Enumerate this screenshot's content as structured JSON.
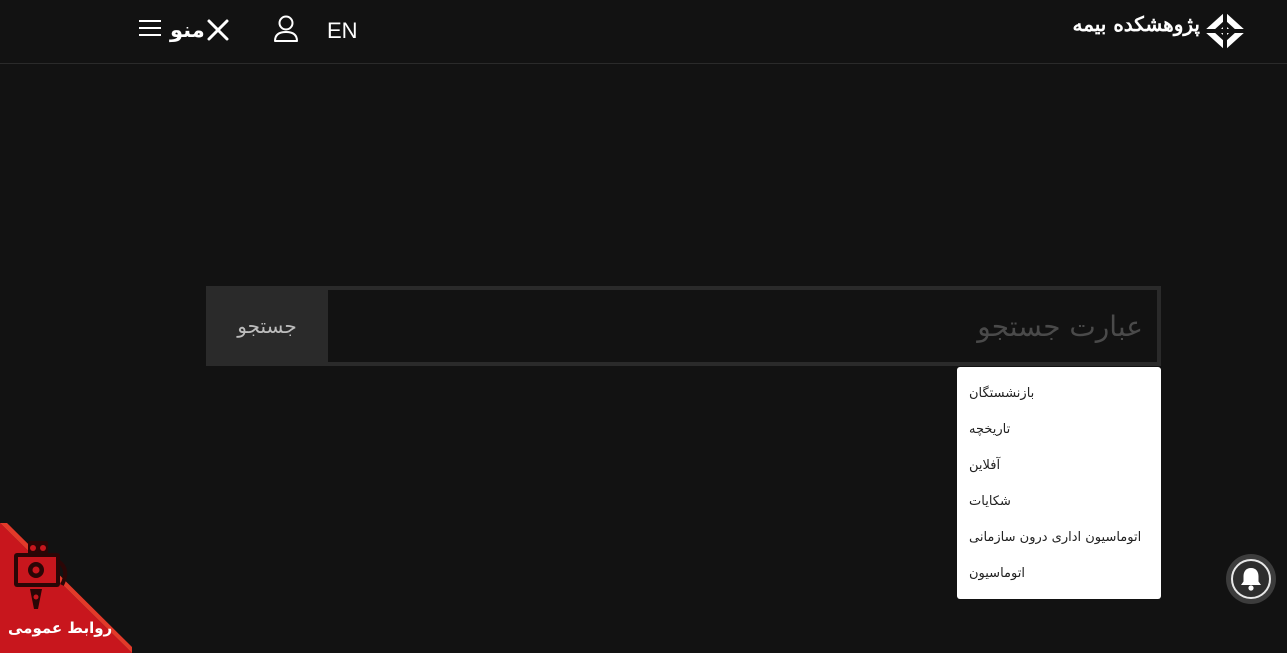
{
  "header": {
    "menu_label": "منو",
    "lang_label": "EN",
    "logo_text": "پژوهشکده بیمه",
    "icons": {
      "hamburger": "hamburger-icon",
      "close": "close-icon",
      "user": "user-icon",
      "logo": "diamond-logo-icon"
    }
  },
  "search": {
    "button_label": "جستجو",
    "placeholder": "عبارت جستجو",
    "value": ""
  },
  "suggestions": [
    "بازنشستگان",
    "تاریخچه",
    "آفلاین",
    "شکایات",
    "اتوماسیون اداری درون سازمانی",
    "اتوماسیون"
  ],
  "notification": {
    "icon": "bell-icon"
  },
  "public_relations": {
    "label": "روابط عمومی",
    "icon": "public-relations-icon"
  },
  "colors": {
    "background": "#121212",
    "search_button_bg": "#2a2a2a",
    "badge_red": "#c8161d",
    "dropdown_bg": "#ffffff"
  }
}
